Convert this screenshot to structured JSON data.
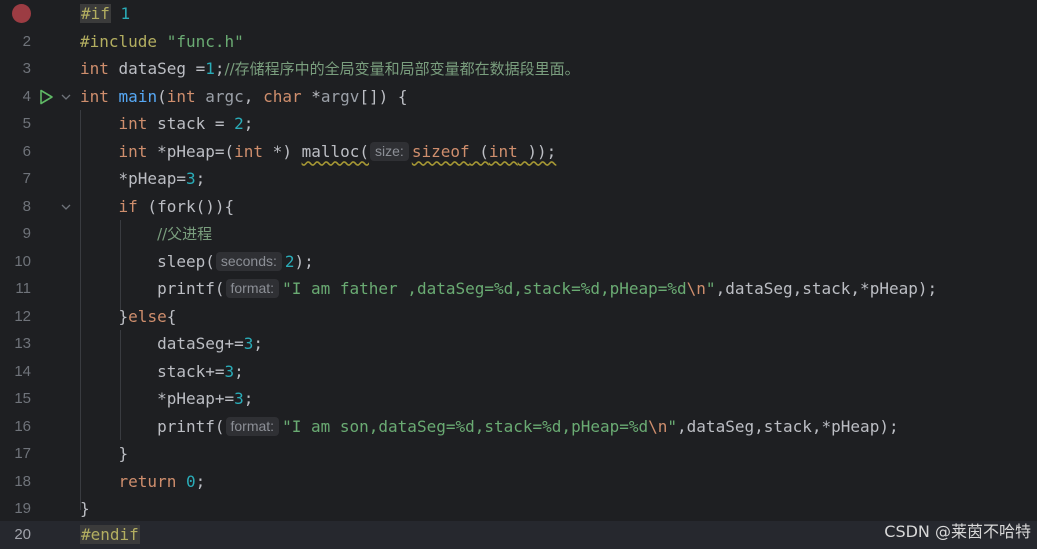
{
  "editor": {
    "lines": [
      {
        "n": "1",
        "has_breakpoint": true
      },
      {
        "n": "2"
      },
      {
        "n": "3"
      },
      {
        "n": "4",
        "run": true
      },
      {
        "n": "5"
      },
      {
        "n": "6"
      },
      {
        "n": "7"
      },
      {
        "n": "8"
      },
      {
        "n": "9"
      },
      {
        "n": "10"
      },
      {
        "n": "11"
      },
      {
        "n": "12"
      },
      {
        "n": "13"
      },
      {
        "n": "14"
      },
      {
        "n": "15"
      },
      {
        "n": "16"
      },
      {
        "n": "17"
      },
      {
        "n": "18"
      },
      {
        "n": "19"
      },
      {
        "n": "20",
        "current": true
      }
    ],
    "code": {
      "l1_directive": "#if",
      "l1_value": "1",
      "l2_directive": "#include",
      "l2_file": "\"func.h\"",
      "l3_type": "int",
      "l3_rest": " dataSeg =",
      "l3_num": "1",
      "l3_semi": ";",
      "l3_comment": "//存储程序中的全局变量和局部变量都在数据段里面。",
      "l4_type": "int",
      "l4_fn": "main",
      "l4_open": "(",
      "l4_type2": "int",
      "l4_p1": "argc",
      "l4_mid": ", ",
      "l4_type3": "char",
      "l4_star": " *",
      "l4_p2": "argv",
      "l4_close": "[]) {",
      "l5_type": "int",
      "l5_rest": " stack = ",
      "l5_num": "2",
      "l5_semi": ";",
      "l6_type": "int",
      "l6_a": " *pHeap=(",
      "l6_type2": "int",
      "l6_b": " *) ",
      "l6_call": "malloc(",
      "l6_hint": "size:",
      "l6_sizeof": "sizeof",
      "l6_sp": " (",
      "l6_type3": "int",
      "l6_end": " ));",
      "l7_a": "*pHeap=",
      "l7_num": "3",
      "l7_semi": ";",
      "l8_kw": "if",
      "l8_rest": " (fork()){",
      "l9_comment": "//父进程",
      "l10_call": "sleep(",
      "l10_hint": "seconds:",
      "l10_num": "2",
      "l10_end": ");",
      "l11_call": "printf(",
      "l11_hint": "format:",
      "l11_str": "\"I am father ,dataSeg=%d,stack=%d,pHeap=%d",
      "l11_esc": "\\n",
      "l11_strend": "\"",
      "l11_args": ",dataSeg,stack,*pHeap);",
      "l12_a": "}",
      "l12_kw": "else",
      "l12_b": "{",
      "l13_a": "dataSeg+=",
      "l13_num": "3",
      "l13_semi": ";",
      "l14_a": "stack+=",
      "l14_num": "3",
      "l14_semi": ";",
      "l15_a": "*pHeap+=",
      "l15_num": "3",
      "l15_semi": ";",
      "l16_call": "printf(",
      "l16_hint": "format:",
      "l16_str": "\"I am son,dataSeg=%d,stack=%d,pHeap=%d",
      "l16_esc": "\\n",
      "l16_strend": "\"",
      "l16_args": ",dataSeg,stack,*pHeap);",
      "l17": "}",
      "l18_kw": "return",
      "l18_num": "0",
      "l18_semi": ";",
      "l19": "}",
      "l20_directive": "#endif"
    }
  },
  "watermark": "CSDN @莱茵不哈特",
  "colors": {
    "background": "#1e1f22",
    "keyword": "#cf8e6d",
    "number": "#2aacb8",
    "string": "#6aab73",
    "function": "#56a8f5",
    "preprocessor": "#b3ae60",
    "breakpoint": "#9c3c43"
  }
}
